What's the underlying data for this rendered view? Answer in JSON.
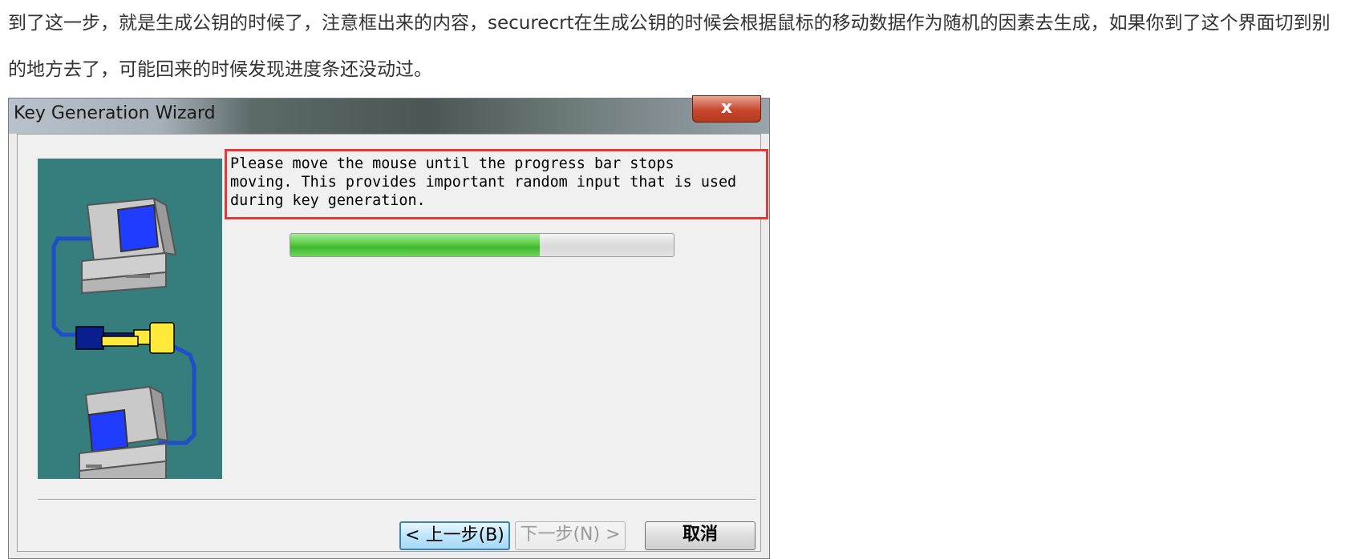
{
  "article": {
    "paragraph1": "到了这一步，就是生成公钥的时候了，注意框出来的内容，securecrt在生成公钥的时候会根据鼠标的移动数据作为随机的因素去生成，如果你到了这个界面切到别的地方去了，可能回来的时候发现进度条还没动过。"
  },
  "dialog": {
    "title": "Key Generation Wizard",
    "close_label": "x",
    "message": "Please move the mouse until the progress bar stops\nmoving. This provides important random input that is used\nduring key generation.",
    "progress_fraction": 0.65,
    "buttons": {
      "back": "< 上一步(B)",
      "next": "下一步(N) >",
      "cancel": "取消"
    }
  },
  "colors": {
    "side_panel": "#367d7d",
    "highlight_border": "#e53935",
    "progress_fill": "#4fc53b",
    "monitor_screen": "#1f3cff",
    "key_blue": "#0a1f8f",
    "key_yellow": "#ffea3b",
    "cable": "#1e4fc8"
  },
  "icons": [
    "computer-icon",
    "key-icon",
    "computer-icon"
  ]
}
